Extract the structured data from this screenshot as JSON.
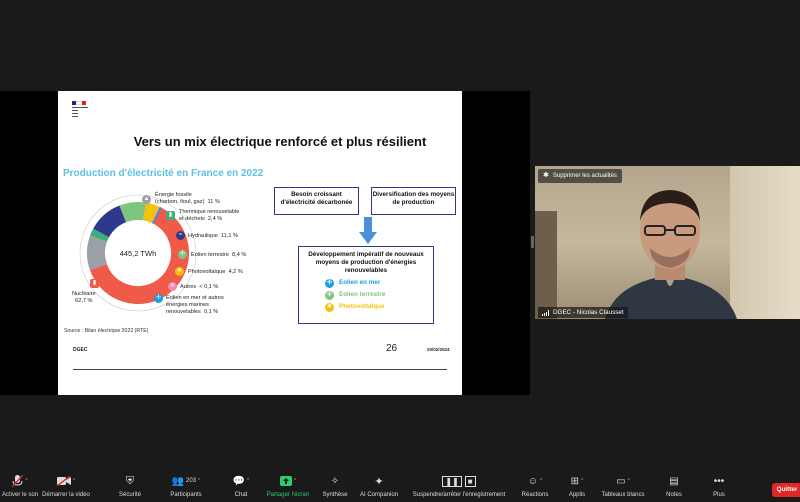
{
  "slide": {
    "title": "Vers un mix électrique renforcé et plus résilient",
    "chart_title": "Production d'électricité en France en 2022",
    "center_label": "445,2 TWh",
    "source": "Source : Bilan électrique 2022 (RTE)",
    "footer_left": "DGEC",
    "page_number": "26",
    "date": "20/02/2024",
    "box_need": "Besoin croissant d'électricité décarbonée",
    "box_div": "Diversification des moyens de production",
    "box_dev": "Développement impératif de nouveaux moyens de production d'énergies renouvelables",
    "dev_items": [
      {
        "label": "Eolien en mer",
        "color": "#1a9ee0"
      },
      {
        "label": "Eolien terrestre",
        "color": "#7fc47f"
      },
      {
        "label": "Photovoltaïque",
        "color": "#f4c20d"
      }
    ],
    "colors": {
      "nuclear": "#ef5b48",
      "hydro": "#2d3a8c",
      "accent_title": "#5cc0e0",
      "box_border": "#2d3a8c"
    }
  },
  "chart_data": {
    "type": "pie",
    "title": "Production d'électricité en France en 2022",
    "center_label": "445,2 TWh",
    "slices": [
      {
        "label": "Nucléaire",
        "value": 62.7,
        "display": "62,7 %",
        "color": "#ef5b48"
      },
      {
        "label": "Énergie fossile (charbon, fioul, gaz)",
        "value": 11,
        "display": "11 %",
        "color": "#9aa0a6"
      },
      {
        "label": "Thermique renouvelable et déchets",
        "value": 2.4,
        "display": "2,4 %",
        "color": "#3fae7a"
      },
      {
        "label": "Hydraulique",
        "value": 11.1,
        "display": "11,1 %",
        "color": "#2d3a8c"
      },
      {
        "label": "Eolien terrestre",
        "value": 8.4,
        "display": "8,4 %",
        "color": "#7fc47f"
      },
      {
        "label": "Photovoltaïque",
        "value": 4.2,
        "display": "4,2 %",
        "color": "#f4c20d"
      },
      {
        "label": "Autres",
        "value": 0.1,
        "display": "< 0,1 %",
        "color": "#f28ab2"
      },
      {
        "label": "Eolien en mer et autres énergies marines renouvelables",
        "value": 0.1,
        "display": "0,1 %",
        "color": "#1a9ee0"
      }
    ]
  },
  "labels": {
    "fossil_1": "Énergie fossile",
    "fossil_2": "(charbon, fioul, gaz)",
    "fossil_pct": "11 %",
    "thermal_1": "Thermique renouvelable",
    "thermal_2": "et déchets",
    "thermal_pct": "2,4 %",
    "hydro": "Hydraulique",
    "hydro_pct": "11,1 %",
    "wind": "Eolien terrestre",
    "wind_pct": "8,4 %",
    "pv": "Photovoltaïque",
    "pv_pct": "4,2 %",
    "other": "Autres",
    "other_pct": "< 0,1 %",
    "offshore_1": "Eolien en mer et autres",
    "offshore_2": "énergies marines",
    "offshore_3": "renouvelables",
    "offshore_pct": "0,1 %",
    "nuclear": "Nucléaire",
    "nuclear_pct": "62,7 %"
  },
  "video": {
    "unpin_label": "Supprimer les actualités",
    "participant_name": "DGEC - Nicolas Clausset"
  },
  "toolbar": {
    "mute": "Activer le son",
    "video": "Démarrer la vidéo",
    "security": "Sécurité",
    "participants": "Participants",
    "participants_count": "203",
    "chat": "Chat",
    "share": "Partager l'écran",
    "summary": "Synthèse",
    "ai": "AI Companion",
    "record": "Suspendre/arrêter l'enregistrement",
    "reactions": "Réactions",
    "apps": "Applis",
    "whiteboards": "Tableaux blancs",
    "notes": "Notes",
    "more": "Plus",
    "quit": "Quitter"
  }
}
